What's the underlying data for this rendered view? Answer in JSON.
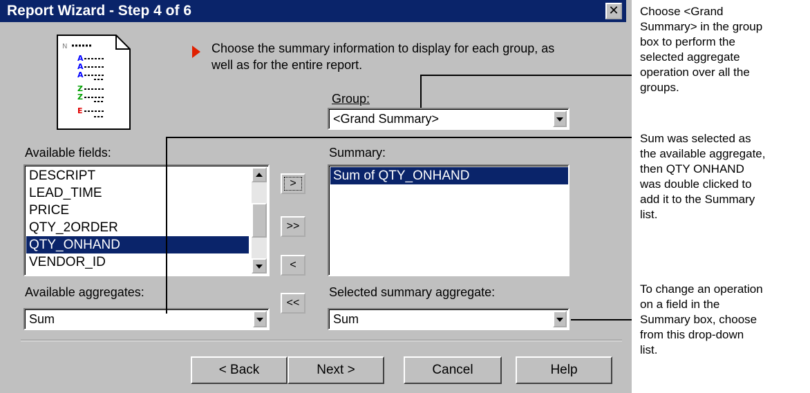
{
  "window": {
    "title": "Report Wizard - Step 4 of 6",
    "close_glyph": "✕"
  },
  "instruction": {
    "line1": "Choose the summary information to display for each group, as",
    "line2": "well as for the entire report."
  },
  "group": {
    "label": "Group:",
    "value": "<Grand Summary>"
  },
  "available_fields": {
    "label": "Available fields:",
    "items": [
      "DESCRIPT",
      "LEAD_TIME",
      "PRICE",
      "QTY_2ORDER",
      "QTY_ONHAND",
      "VENDOR_ID"
    ],
    "selected": "QTY_ONHAND"
  },
  "summary": {
    "label": "Summary:",
    "items": [
      "Sum of QTY_ONHAND"
    ]
  },
  "move_buttons": {
    "add": ">",
    "add_all": ">>",
    "remove": "<",
    "remove_all": "<<"
  },
  "available_aggregates": {
    "label": "Available aggregates:",
    "value": "Sum"
  },
  "selected_aggregate": {
    "label": "Selected summary aggregate:",
    "value": "Sum"
  },
  "buttons": {
    "back": "< Back",
    "next": "Next >",
    "cancel": "Cancel",
    "help": "Help"
  },
  "callouts": {
    "group": [
      "Choose <Grand",
      "Summary> in the group",
      "box to perform the",
      "selected aggregate",
      "operation over all the",
      "groups."
    ],
    "aggregate": [
      "Sum was selected as",
      "the available aggregate,",
      "then QTY ONHAND",
      "was double clicked to",
      "add it to the Summary",
      "list."
    ],
    "dropdown": [
      "To change an operation",
      "on a field in the",
      "Summary box, choose",
      "from this drop-down",
      "list."
    ]
  },
  "colors": {
    "title_bar": "#0a246a",
    "dialog_face": "#c0c0c0",
    "selection": "#0a246a",
    "arrow_bullet": "#e02000"
  },
  "icons": [
    "report-document-icon",
    "arrow-bullet-icon",
    "close-icon",
    "dropdown-arrow-icon",
    "scroll-up-icon",
    "scroll-down-icon"
  ]
}
